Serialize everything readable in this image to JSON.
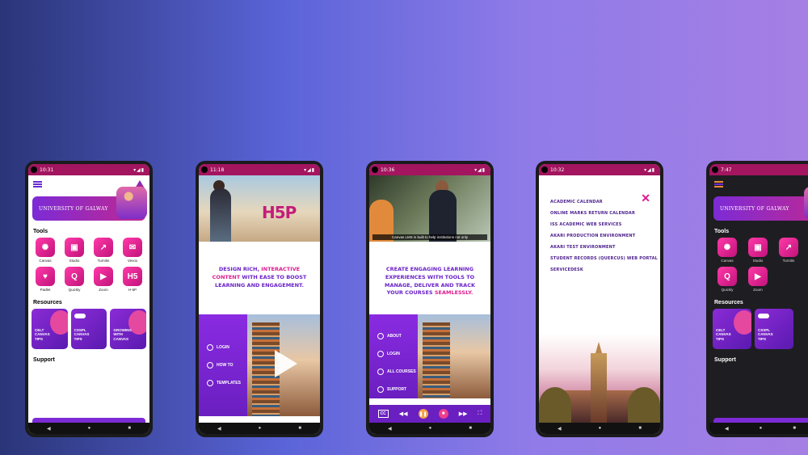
{
  "phones": [
    {
      "time": "10:31",
      "university": "UNIVERSITY OF GALWAY",
      "tools_title": "Tools",
      "tools": [
        "Canvas",
        "Studio",
        "Turnitin",
        "Vevox",
        "Padlet",
        "Quickly",
        "Zoom",
        "H-5P"
      ],
      "tool_icons": [
        "canvas-icon",
        "studio-icon",
        "turnitin-icon",
        "vevox-icon",
        "padlet-icon",
        "quickly-icon",
        "zoom-icon",
        "h5p-icon"
      ],
      "resources_title": "Resources",
      "resources": [
        "CELT CANVAS TIPS",
        "CSSPL CANVAS TIPS",
        "GROWING WITH CANVAS"
      ],
      "support_title": "Support"
    },
    {
      "time": "11:18",
      "h5p": "H5P",
      "headline_pre": "DESIGN RICH,",
      "headline_hl": "INTERACTIVE CONTENT",
      "headline_post": "WITH EASE TO BOOST LEARNING AND ENGAGEMENT.",
      "menu": [
        "LOGIN",
        "HOW TO",
        "TEMPLATES"
      ]
    },
    {
      "time": "10:36",
      "caption": "Canvas LMS is built to help institutions not only",
      "headline_pre": "CREATE ENGAGING LEARNING EXPERIENCES WITH TOOLS TO MANAGE, DELIVER AND TRACK YOUR COURSES",
      "headline_hl": "SEAMLESSLY.",
      "menu": [
        "ABOUT",
        "LOGIN",
        "ALL COURSES",
        "SUPPORT"
      ],
      "cc": "CC"
    },
    {
      "time": "10:32",
      "links": [
        "ACADEMIC CALENDAR",
        "ONLINE MARKS RETURN CALENDAR",
        "ISS ACADEMIC WEB SERVICES",
        "AKARI PRODUCTION ENVIRONMENT",
        "AKARI TEST ENVIRONMENT",
        "STUDENT RECORDS (QUERCUS) WEB PORTAL",
        "SERVICEDESK"
      ]
    },
    {
      "time": "7:47",
      "university": "UNIVERSITY OF GALWAY",
      "tools_title": "Tools",
      "tools": [
        "Canvas",
        "Studio",
        "Turnitin",
        "Padlet",
        "Quickly",
        "Zoom"
      ],
      "tool_icons": [
        "canvas-icon",
        "studio-icon",
        "turnitin-icon",
        "padlet-icon",
        "quickly-icon",
        "zoom-icon"
      ],
      "resources_title": "Resources",
      "resources": [
        "CELT CANVAS TIPS",
        "CSSPL CANVAS TIPS"
      ],
      "support_title": "Support"
    }
  ],
  "colors": {
    "accent": "#a3155f",
    "purple": "#6a22c7",
    "pink": "#e01b8f"
  }
}
